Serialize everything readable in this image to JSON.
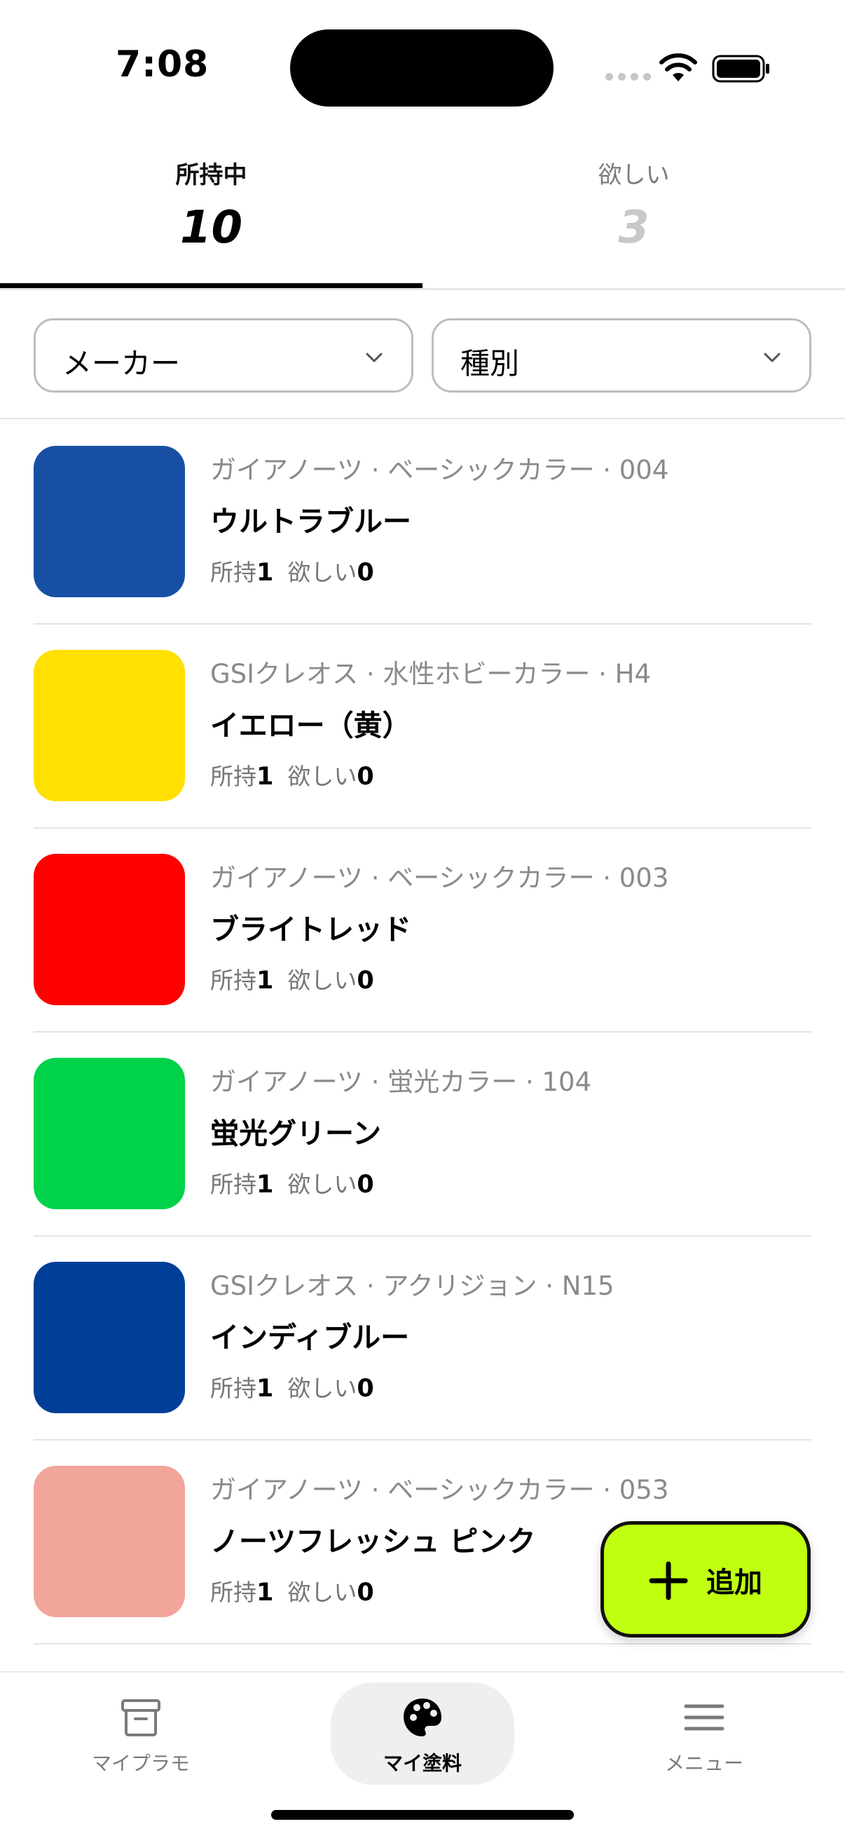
{
  "status_bar": {
    "time": "7:08"
  },
  "tabs": {
    "owned": {
      "label": "所持中",
      "count": "10"
    },
    "wanted": {
      "label": "欲しい",
      "count": "3"
    }
  },
  "filters": {
    "maker": {
      "label": "メーカー"
    },
    "kind": {
      "label": "種別"
    }
  },
  "paints": [
    {
      "meta": "ガイアノーツ · ベーシックカラー · 004",
      "name": "ウルトラブルー",
      "color": "#164fa4",
      "owned_label": "所持",
      "owned": "1",
      "wanted_label": "欲しい",
      "wanted": "0"
    },
    {
      "meta": "GSIクレオス · 水性ホビーカラー · H4",
      "name": "イエロー（黄）",
      "color": "#ffe000",
      "owned_label": "所持",
      "owned": "1",
      "wanted_label": "欲しい",
      "wanted": "0"
    },
    {
      "meta": "ガイアノーツ · ベーシックカラー · 003",
      "name": "ブライトレッド",
      "color": "#ff0000",
      "owned_label": "所持",
      "owned": "1",
      "wanted_label": "欲しい",
      "wanted": "0"
    },
    {
      "meta": "ガイアノーツ · 蛍光カラー · 104",
      "name": "蛍光グリーン",
      "color": "#00d34a",
      "owned_label": "所持",
      "owned": "1",
      "wanted_label": "欲しい",
      "wanted": "0"
    },
    {
      "meta": "GSIクレオス · アクリジョン · N15",
      "name": "インディブルー",
      "color": "#003f98",
      "owned_label": "所持",
      "owned": "1",
      "wanted_label": "欲しい",
      "wanted": "0"
    },
    {
      "meta": "ガイアノーツ · ベーシックカラー · 053",
      "name": "ノーツフレッシュ ピンク",
      "color": "#f2a59a",
      "owned_label": "所持",
      "owned": "1",
      "wanted_label": "欲しい",
      "wanted": "0"
    },
    {
      "meta": "",
      "name": "",
      "color": "#f4a8a4",
      "owned_label": "",
      "owned": "",
      "wanted_label": "",
      "wanted": ""
    }
  ],
  "fab": {
    "label": "追加",
    "color": "#bfff0f"
  },
  "bottom_nav": {
    "plamo": {
      "label": "マイプラモ",
      "icon": "archive-box-icon"
    },
    "paint": {
      "label": "マイ塗料",
      "icon": "palette-icon"
    },
    "menu": {
      "label": "メニュー",
      "icon": "hamburger-menu-icon"
    }
  }
}
